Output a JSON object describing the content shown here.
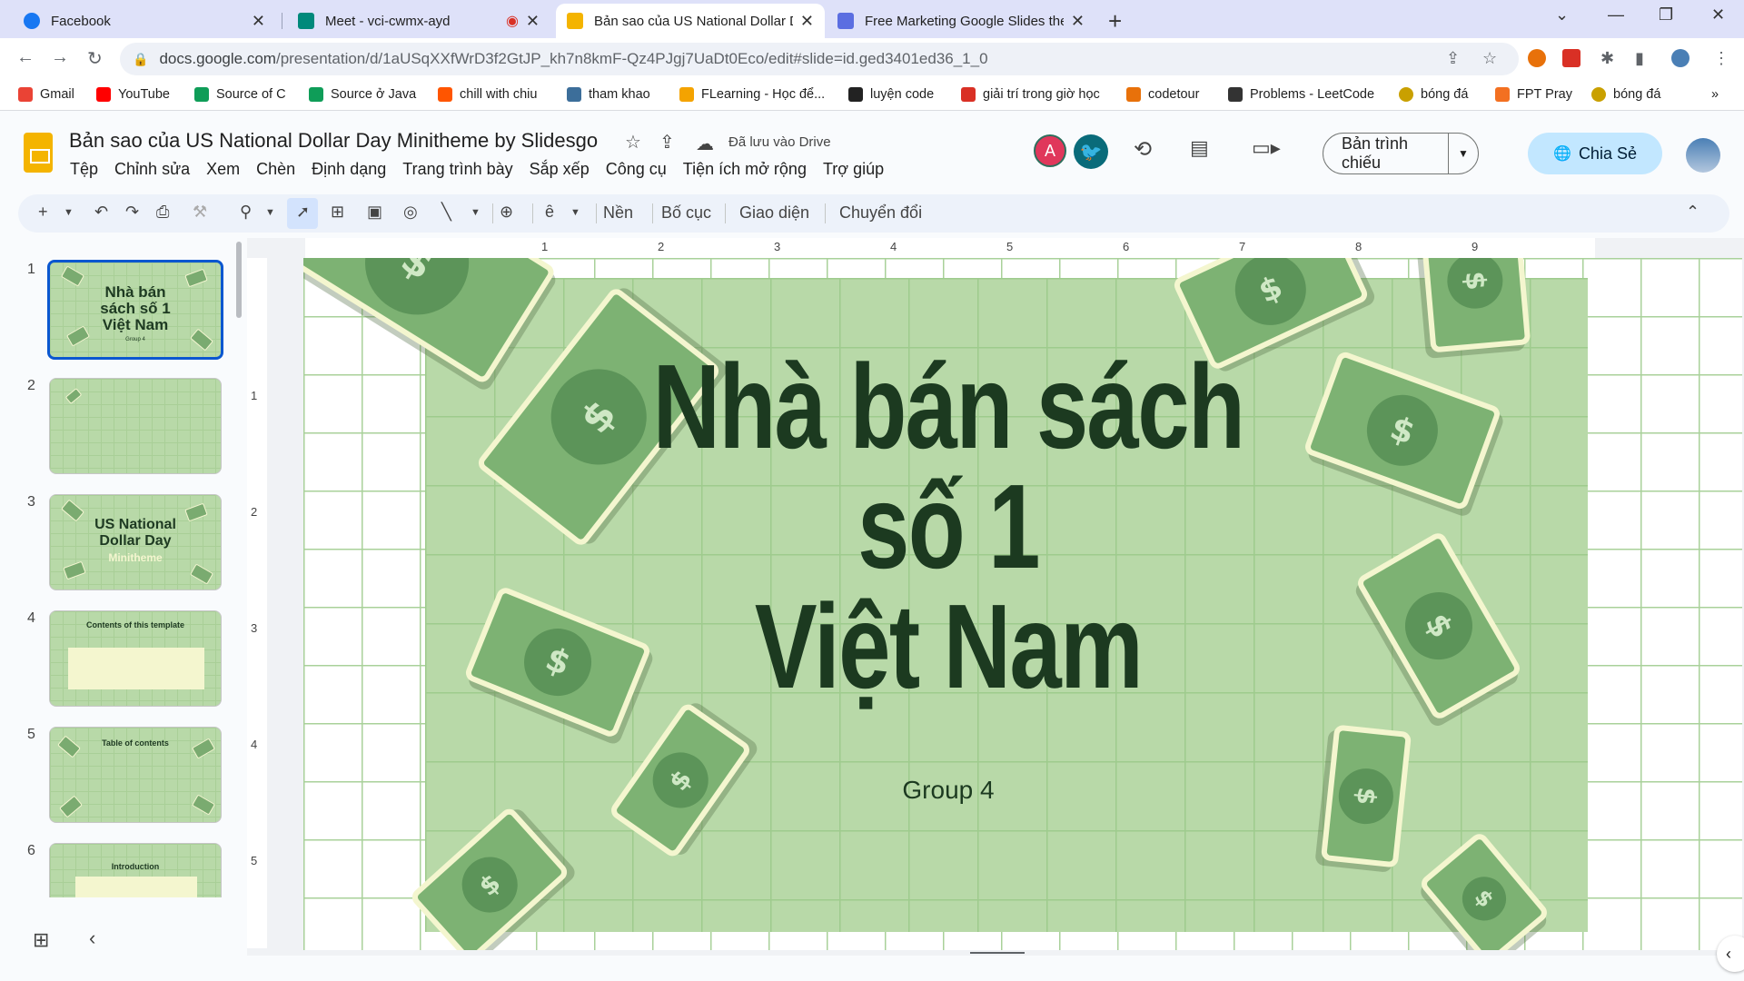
{
  "browser": {
    "tabs": [
      {
        "title": "Facebook",
        "favicon": "facebook-icon",
        "color": "#1877f2"
      },
      {
        "title": "Meet - vci-cwmx-ayd",
        "favicon": "meet-icon",
        "color": "#00897b"
      },
      {
        "title": "Bản sao của US National Dollar D",
        "favicon": "slides-icon",
        "color": "#f4b400"
      },
      {
        "title": "Free Marketing Google Slides the",
        "favicon": "slidesgo-icon",
        "color": "#5b6ee1"
      }
    ],
    "url_host": "docs.google.com",
    "url_path": "/presentation/d/1aUSqXXfWrD3f2GtJP_kh7n8kmF-Qz4PJgj7UaDt0Eco/edit#slide=id.ged3401ed36_1_0",
    "bookmarks": [
      {
        "label": "Gmail",
        "color": "#ea4335"
      },
      {
        "label": "YouTube",
        "color": "#ff0000"
      },
      {
        "label": "Source of C",
        "color": "#0f9d58"
      },
      {
        "label": "Source ở Java",
        "color": "#0f9d58"
      },
      {
        "label": "chill with chiu",
        "color": "#ff5500"
      },
      {
        "label": "tham khao",
        "color": "#3c6e9a"
      },
      {
        "label": "FLearning - Học để...",
        "color": "#f4a300"
      },
      {
        "label": "luyện code",
        "color": "#222222"
      },
      {
        "label": "giải trí trong giờ học",
        "color": "#d93025"
      },
      {
        "label": "codetour",
        "color": "#e8710a"
      },
      {
        "label": "Problems - LeetCode",
        "color": "#333333"
      },
      {
        "label": "bóng đá",
        "color": "#c9a000"
      },
      {
        "label": "FPT Pray",
        "color": "#f37021"
      },
      {
        "label": "bóng đá",
        "color": "#c9a000"
      }
    ]
  },
  "doc": {
    "title": "Bản sao của US National Dollar Day Minitheme by Slidesgo",
    "saved": "Đã lưu vào Drive",
    "menus": [
      "Tệp",
      "Chỉnh sửa",
      "Xem",
      "Chèn",
      "Định dạng",
      "Trang trình bày",
      "Sắp xếp",
      "Công cụ",
      "Tiện ích mở rộng",
      "Trợ giúp"
    ],
    "avatar_letter": "A",
    "present_label": "Bản trình chiếu",
    "share_label": "Chia Sẻ"
  },
  "toolbar": {
    "background": "Nền",
    "layout": "Bố cục",
    "theme": "Giao diện",
    "transition": "Chuyển đổi"
  },
  "ruler": {
    "h": [
      "1",
      "2",
      "3",
      "4",
      "5",
      "6",
      "7",
      "8",
      "9"
    ],
    "v": [
      "1",
      "2",
      "3",
      "4",
      "5"
    ]
  },
  "filmstrip": [
    {
      "num": "1",
      "title": "Nhà bán sách số 1 Việt Nam",
      "sub": "Group 4"
    },
    {
      "num": "2",
      "title": "",
      "sub": ""
    },
    {
      "num": "3",
      "title": "US National Dollar Day",
      "sub": "Minitheme"
    },
    {
      "num": "4",
      "title": "Contents of this template",
      "sub": ""
    },
    {
      "num": "5",
      "title": "Table of contents",
      "sub": ""
    },
    {
      "num": "6",
      "title": "Introduction",
      "sub": ""
    }
  ],
  "slide": {
    "title_lines": [
      "Nhà bán sách",
      "số 1",
      "Việt Nam"
    ],
    "subtitle": "Group 4",
    "bill_symbol": "$",
    "colors": {
      "bg": "#b8d9a8",
      "bill": "#7db273",
      "text": "#1c3a20"
    }
  }
}
